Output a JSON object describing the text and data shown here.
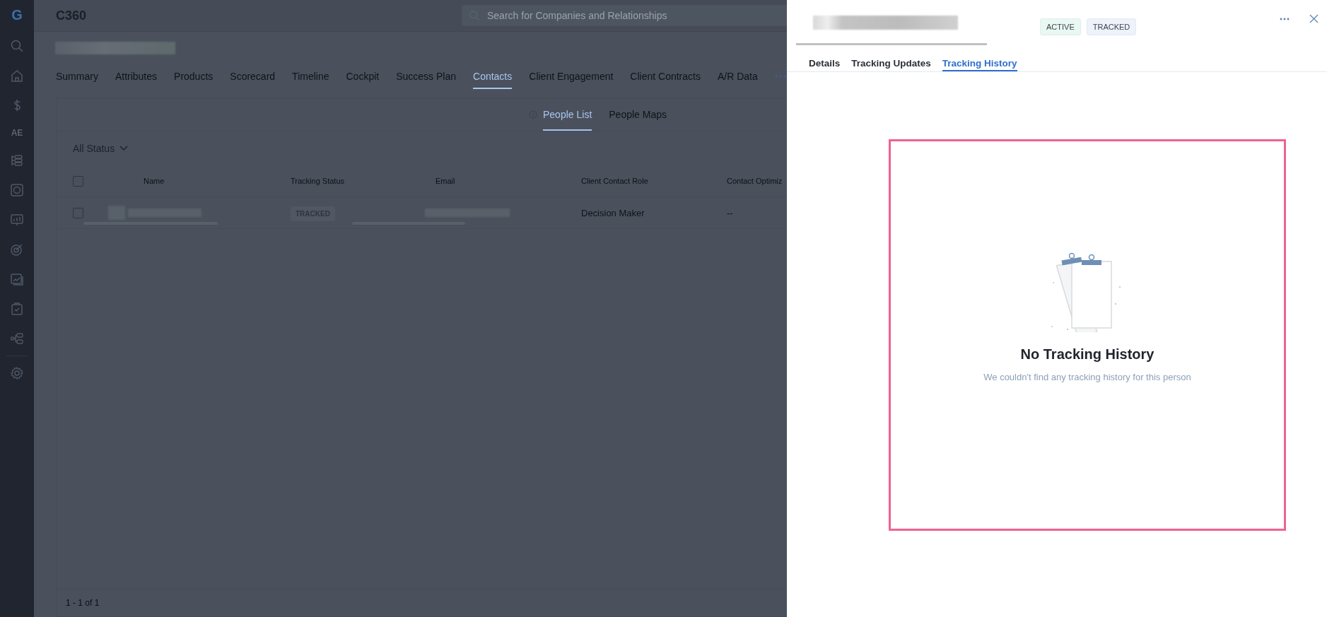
{
  "app": {
    "logo": "G",
    "title": "C360",
    "search": {
      "placeholder": "Search for Companies and Relationships"
    }
  },
  "sidebar": {
    "label": "AE"
  },
  "tabs": [
    {
      "label": "Summary",
      "selected": false
    },
    {
      "label": "Attributes",
      "selected": false
    },
    {
      "label": "Products",
      "selected": false
    },
    {
      "label": "Scorecard",
      "selected": false
    },
    {
      "label": "Timeline",
      "selected": false
    },
    {
      "label": "Cockpit",
      "selected": false
    },
    {
      "label": "Success Plan",
      "selected": false
    },
    {
      "label": "Contacts",
      "selected": true
    },
    {
      "label": "Client Engagement",
      "selected": false
    },
    {
      "label": "Client Contracts",
      "selected": false
    },
    {
      "label": "A/R Data",
      "selected": false
    }
  ],
  "view_tabs": [
    {
      "label": "People List",
      "selected": true
    },
    {
      "label": "People Maps",
      "selected": false
    }
  ],
  "filter": {
    "label": "All Status"
  },
  "table": {
    "select_all": {
      "checked": false
    },
    "columns": [
      "Name",
      "Tracking Status",
      "Email",
      "Client Contact Role",
      "Contact Optimiz"
    ],
    "rows": [
      {
        "checked": false,
        "tracking_status": "TRACKED",
        "client_contact_role": "Decision Maker",
        "column_5": "--"
      }
    ]
  },
  "pagination": "1 - 1 of 1",
  "panel": {
    "badges": [
      {
        "label": "ACTIVE",
        "color": "#e9f8f1"
      },
      {
        "label": "TRACKED",
        "color": "#eef2fa"
      }
    ],
    "tabs": [
      {
        "label": "Details",
        "selected": false
      },
      {
        "label": "Tracking Updates",
        "selected": false
      },
      {
        "label": "Tracking History",
        "selected": true
      }
    ],
    "empty_state": {
      "title": "No Tracking History",
      "message": "We couldn't find any tracking history for this person"
    }
  }
}
